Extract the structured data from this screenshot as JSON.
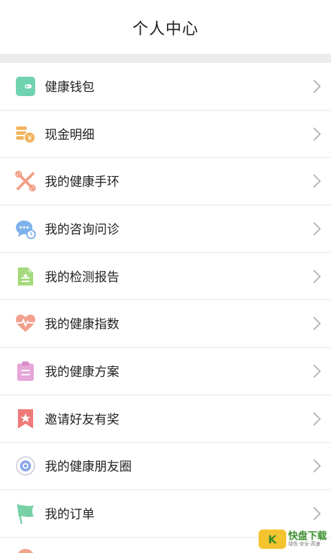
{
  "header": {
    "title": "个人中心"
  },
  "menu": [
    {
      "label": "健康钱包",
      "icon": "wallet-icon",
      "color": "#6fd3b0"
    },
    {
      "label": "现金明细",
      "icon": "coins-icon",
      "color": "#f2b45e"
    },
    {
      "label": "我的健康手环",
      "icon": "tools-icon",
      "color": "#f29f86"
    },
    {
      "label": "我的咨询问诊",
      "icon": "chat-bubble-icon",
      "color": "#7fb2ea"
    },
    {
      "label": "我的检测报告",
      "icon": "report-icon",
      "color": "#a3d97a"
    },
    {
      "label": "我的健康指数",
      "icon": "heart-pulse-icon",
      "color": "#f3a08e"
    },
    {
      "label": "我的健康方案",
      "icon": "clipboard-icon",
      "color": "#e6a6d8"
    },
    {
      "label": "邀请好友有奖",
      "icon": "bookmark-star-icon",
      "color": "#f07a7a"
    },
    {
      "label": "我的健康朋友圈",
      "icon": "aperture-icon",
      "color": "#8aa7e8"
    },
    {
      "label": "我的订单",
      "icon": "flag-icon",
      "color": "#78d0a6"
    }
  ],
  "watermark": {
    "logo": "K",
    "main": "快盘下载",
    "sub": "绿色·安全·高速"
  }
}
